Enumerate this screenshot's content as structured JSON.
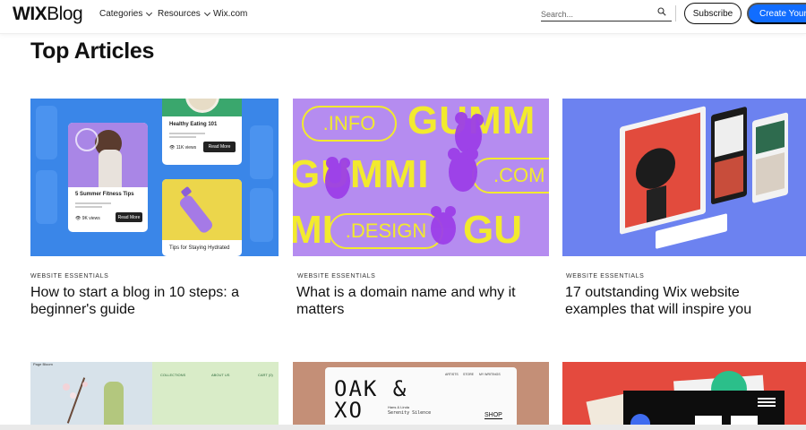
{
  "header": {
    "logo_bold": "WIX",
    "logo_rest": "Blog",
    "nav": [
      {
        "label": "Categories",
        "dropdown": true
      },
      {
        "label": "Resources",
        "dropdown": true
      },
      {
        "label": "Wix.com",
        "dropdown": false
      }
    ],
    "search_placeholder": "Search...",
    "subscribe_label": "Subscribe",
    "create_label": "Create Your W"
  },
  "section_title": "Top Articles",
  "articles": [
    {
      "tag": "WEBSITE ESSENTIALS",
      "title": "How to start a blog in 10 steps: a beginner's guide",
      "image": {
        "card_a_title": "Healthy Eating 101",
        "card_a_views": "11K views",
        "card_a_btn": "Read More",
        "card_b_title": "5 Summer Fitness Tips",
        "card_b_views": "9K views",
        "card_b_btn": "Read More",
        "card_c_title": "Tips for Staying Hydrated"
      }
    },
    {
      "tag": "WEBSITE ESSENTIALS",
      "title": "What is a domain name and why it matters",
      "image": {
        "word": "GUMMI",
        "pills": [
          ".INFO",
          ".COM",
          ".DESIGN"
        ],
        "row1_word": "GUMM",
        "row3_left": "MI",
        "row3_right": "GU"
      }
    },
    {
      "tag": "WEBSITE ESSENTIALS",
      "title": "17 outstanding Wix website examples that will inspire you"
    }
  ],
  "row2": {
    "card1": {
      "brand": "Page Bloom",
      "nav": [
        "COLLECTIONS",
        "ABOUT US",
        "CART (0)"
      ]
    },
    "card2": {
      "brand_line1": "OAK &",
      "brand_line2": "XO",
      "sub1": "Hans & Linda",
      "sub2": "Serenity Silence",
      "nav": [
        "ARTISTS",
        "STORE",
        "MY WRITINGS"
      ],
      "shop": "SHOP"
    }
  },
  "colors": {
    "accent": "#116dff",
    "img1_bg": "#3a86e8",
    "img2_bg": "#b58cf0",
    "img2_word": "#f2ea2e",
    "img3_bg": "#6c82f0"
  }
}
